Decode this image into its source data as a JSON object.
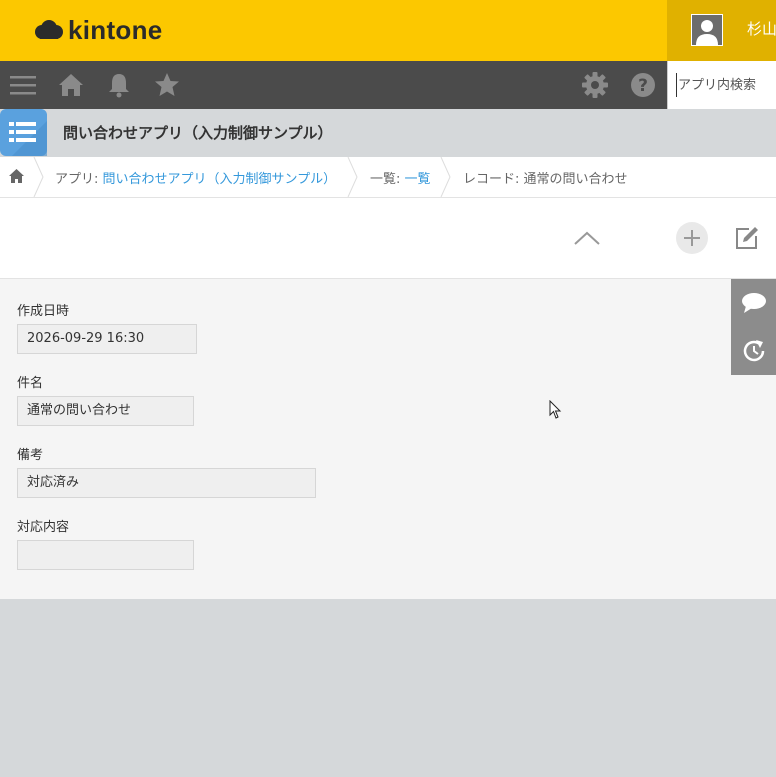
{
  "header": {
    "logo_text": "kintone",
    "user_name": "杉山",
    "brand_color": "#fcc800"
  },
  "navbar": {
    "icons": [
      "menu-icon",
      "home-icon",
      "bell-icon",
      "star-icon",
      "gear-icon",
      "help-icon"
    ],
    "search_placeholder": "アプリ内検索"
  },
  "app": {
    "title": "問い合わせアプリ（入力制御サンプル）",
    "icon": "list-icon"
  },
  "breadcrumb": {
    "app_prefix": "アプリ: ",
    "app_link": "問い合わせアプリ（入力制御サンプル）",
    "list_prefix": "一覧: ",
    "list_link": "一覧",
    "record": "レコード: 通常の問い合わせ"
  },
  "toolbar": {
    "icons": [
      "chevron-up-icon",
      "add-icon",
      "edit-icon"
    ]
  },
  "fields": [
    {
      "label": "作成日時",
      "value": "2026-09-29 16:30"
    },
    {
      "label": "件名",
      "value": "通常の問い合わせ"
    },
    {
      "label": "備考",
      "value": "対応済み"
    },
    {
      "label": "対応内容",
      "value": ""
    }
  ],
  "side_panel": {
    "icons": [
      "comment-icon",
      "history-icon"
    ]
  },
  "colors": {
    "link": "#3498db",
    "navbar": "#4b4b4b",
    "app_icon": "#5aa1de"
  }
}
